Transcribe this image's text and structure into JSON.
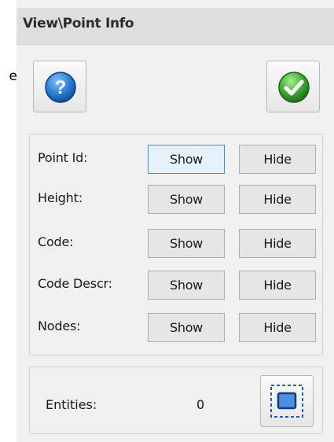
{
  "stray_text": "e",
  "panel": {
    "title": "View\\Point Info"
  },
  "toolbar": {
    "help_icon": "help-question-icon",
    "ok_icon": "green-check-icon"
  },
  "rows": [
    {
      "label": "Point Id:",
      "show": "Show",
      "hide": "Hide"
    },
    {
      "label": "Height:",
      "show": "Show",
      "hide": "Hide"
    },
    {
      "label": "Code:",
      "show": "Show",
      "hide": "Hide"
    },
    {
      "label": "Code Descr:",
      "show": "Show",
      "hide": "Hide"
    },
    {
      "label": "Nodes:",
      "show": "Show",
      "hide": "Hide"
    }
  ],
  "entities": {
    "label": "Entities:",
    "value": "0",
    "select_icon": "selection-rectangle-icon"
  },
  "colors": {
    "focus_border": "#3c8fd6",
    "help_blue": "#1f6fc0",
    "ok_green": "#3da834"
  }
}
